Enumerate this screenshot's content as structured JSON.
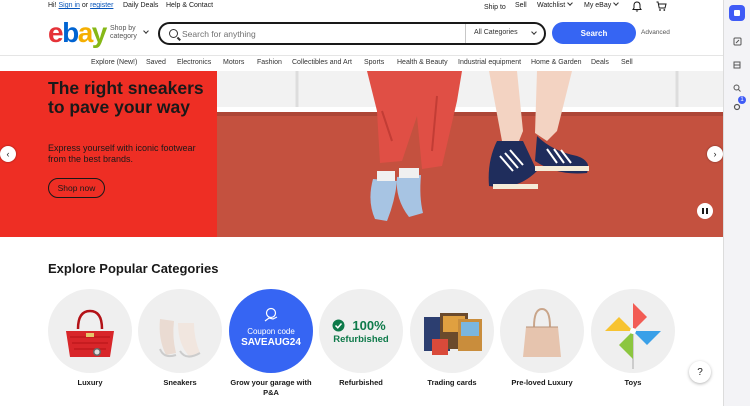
{
  "topbar": {
    "greeting": "Hi!",
    "sign_in": "Sign in",
    "or": "or",
    "register": "register",
    "daily_deals": "Daily Deals",
    "help_contact": "Help & Contact",
    "ship_to": "Ship to",
    "sell": "Sell",
    "watchlist": "Watchlist",
    "my_ebay": "My eBay"
  },
  "header": {
    "logo_letters": [
      "e",
      "b",
      "a",
      "y"
    ],
    "logo_colors": [
      "#e53238",
      "#0064d2",
      "#f5af02",
      "#86b817"
    ],
    "shop_by": "Shop by",
    "category": "category",
    "search_placeholder": "Search for anything",
    "all_categories": "All Categories",
    "search_button": "Search",
    "advanced": "Advanced"
  },
  "nav": [
    "Explore (New!)",
    "Saved",
    "Electronics",
    "Motors",
    "Fashion",
    "Collectibles and Art",
    "Sports",
    "Health & Beauty",
    "Industrial equipment",
    "Home & Garden",
    "Deals",
    "Sell"
  ],
  "hero": {
    "title": "The right sneakers to pave your way",
    "subtitle": "Express yourself with iconic footwear from the best brands.",
    "cta": "Shop now",
    "bg_left": "#ee2e24"
  },
  "categories_title": "Explore Popular Categories",
  "categories": [
    {
      "label": "Luxury"
    },
    {
      "label": "Sneakers"
    },
    {
      "label": "Grow your garage with P&A",
      "coupon_line1": "Coupon code",
      "coupon_line2": "SAVEAUG24"
    },
    {
      "label": "Refurbished",
      "badge": "100%",
      "badge_sub": "Refurbished"
    },
    {
      "label": "Trading cards"
    },
    {
      "label": "Pre-loved Luxury"
    },
    {
      "label": "Toys"
    }
  ],
  "help": "?",
  "sidebar_badge": "1"
}
